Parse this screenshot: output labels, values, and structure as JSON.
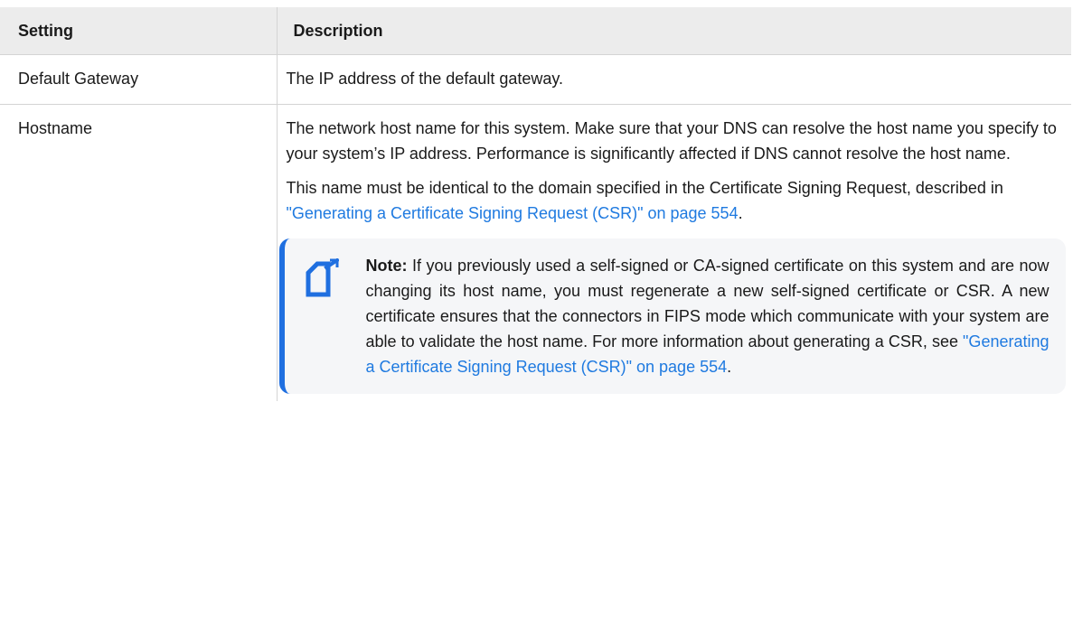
{
  "table": {
    "headers": [
      "Setting",
      "Description"
    ],
    "rows": {
      "gateway": {
        "setting": "Default Gateway",
        "description": "The IP address of the default gateway."
      },
      "hostname": {
        "setting": "Hostname",
        "paragraph1": "The network host name for this system. Make sure that your DNS can resolve the host name you specify to your system’s IP address. Performance is significantly affected if DNS cannot resolve the host name.",
        "paragraph2_prefix": "This name must be identical to the domain specified in the Certificate Signing Request, described in ",
        "paragraph2_link": "\"Generating a Certificate Signing Request (CSR)\" on page 554",
        "paragraph2_suffix": ".",
        "note": {
          "icon": "note-icon",
          "label": "Note:",
          "text": " If you previously used a self-signed or CA-signed certificate on this system and are now changing its host name, you must regenerate a new self-signed certificate or CSR. A new certificate ensures that the connectors in FIPS mode which communicate with your system are able to validate the host name. For more information about generating a CSR, see ",
          "link": "\"Generating a Certificate Signing Request (CSR)\" on page 554",
          "suffix": "."
        }
      }
    }
  },
  "colors": {
    "link": "#1f7ae0",
    "note_accent": "#1f6fe0",
    "header_bg": "#ececec",
    "note_bg": "#f5f6f8"
  }
}
